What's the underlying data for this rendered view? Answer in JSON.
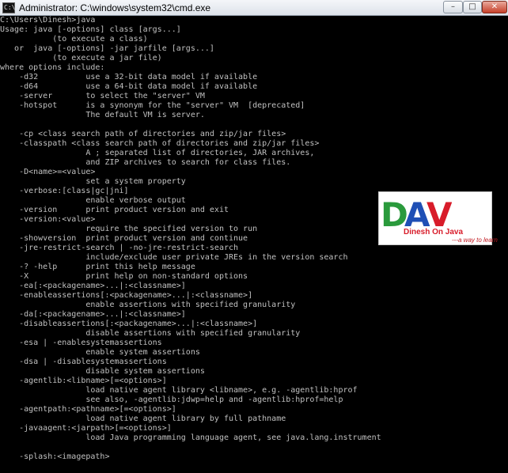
{
  "window": {
    "title": "Administrator: C:\\windows\\system32\\cmd.exe",
    "icon_name": "command-prompt-icon",
    "icon_text": "C:\\",
    "buttons": {
      "minimize": "–",
      "maximize": "□",
      "close": "✕"
    }
  },
  "console": {
    "text_color": "#c0c0c0",
    "background": "#000000",
    "lines": [
      "C:\\Users\\Dinesh>java",
      "Usage: java [-options] class [args...]",
      "           (to execute a class)",
      "   or  java [-options] -jar jarfile [args...]",
      "           (to execute a jar file)",
      "where options include:",
      "    -d32          use a 32-bit data model if available",
      "    -d64          use a 64-bit data model if available",
      "    -server       to select the \"server\" VM",
      "    -hotspot      is a synonym for the \"server\" VM  [deprecated]",
      "                  The default VM is server.",
      "",
      "    -cp <class search path of directories and zip/jar files>",
      "    -classpath <class search path of directories and zip/jar files>",
      "                  A ; separated list of directories, JAR archives,",
      "                  and ZIP archives to search for class files.",
      "    -D<name>=<value>",
      "                  set a system property",
      "    -verbose:[class|gc|jni]",
      "                  enable verbose output",
      "    -version      print product version and exit",
      "    -version:<value>",
      "                  require the specified version to run",
      "    -showversion  print product version and continue",
      "    -jre-restrict-search | -no-jre-restrict-search",
      "                  include/exclude user private JREs in the version search",
      "    -? -help      print this help message",
      "    -X            print help on non-standard options",
      "    -ea[:<packagename>...|:<classname>]",
      "    -enableassertions[:<packagename>...|:<classname>]",
      "                  enable assertions with specified granularity",
      "    -da[:<packagename>...|:<classname>]",
      "    -disableassertions[:<packagename>...|:<classname>]",
      "                  disable assertions with specified granularity",
      "    -esa | -enablesystemassertions",
      "                  enable system assertions",
      "    -dsa | -disablesystemassertions",
      "                  disable system assertions",
      "    -agentlib:<libname>[=<options>]",
      "                  load native agent library <libname>, e.g. -agentlib:hprof",
      "                  see also, -agentlib:jdwp=help and -agentlib:hprof=help",
      "    -agentpath:<pathname>[=<options>]",
      "                  load native agent library by full pathname",
      "    -javaagent:<jarpath>[=<options>]",
      "                  load Java programming language agent, see java.lang.instrument",
      "",
      "    -splash:<imagepath>"
    ]
  },
  "logo": {
    "mark": "DAV",
    "name": "Dinesh On Java",
    "tagline": "---a way to learn",
    "colors": {
      "d": "#2a9a3c",
      "a": "#1f4fb5",
      "v": "#d81c2a",
      "text": "#d81c2a"
    }
  }
}
